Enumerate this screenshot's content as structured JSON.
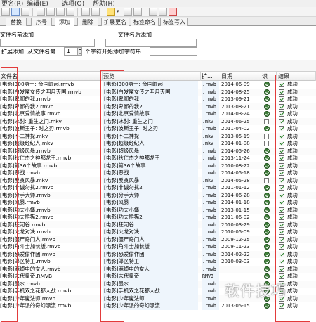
{
  "menubar": {
    "items": [
      "更名(R)",
      "编辑(E)",
      "选项(O)",
      "帮助(H)"
    ]
  },
  "tabs": [
    {
      "label": "替换",
      "active": false
    },
    {
      "label": "序号",
      "active": false
    },
    {
      "label": "添加",
      "active": true
    },
    {
      "label": "删除",
      "active": false
    },
    {
      "label": "扩展更名",
      "active": false
    },
    {
      "label": "标签命名",
      "active": false
    },
    {
      "label": "标签写入",
      "active": false
    }
  ],
  "options": {
    "prefix_label": "文件名前添加",
    "suffix_label": "文件名后添加",
    "ext_add_label": "扩展添加: 从文件名第",
    "ext_add_value": "1",
    "ext_add_suffix": "个字符开始添加字符串"
  },
  "table": {
    "headers": {
      "name": "文件名",
      "preview": "预览",
      "ext": "扩...",
      "date": "日期",
      "icon": "识",
      "result": "结果"
    },
    "rows": [
      {
        "name": "[电影]300勇士: 帝国崛起.rmvb",
        "preview": "[电影]300勇士: 帝国崛起",
        "ext": ".rmvb",
        "date": "2014-06-09",
        "icon": "ok",
        "result": "成功"
      },
      {
        "name": "[电影]白发魔女传之明月天国.rmvb",
        "preview": "[电影]白发魔女传之明月天国",
        "ext": ".rmvb",
        "date": "2014-08-25",
        "icon": "ok",
        "result": "成功"
      },
      {
        "name": "[电影]卑鄙的我.rmvb",
        "preview": "[电影]卑鄙的我",
        "ext": ".rmvb",
        "date": "2013-09-21",
        "icon": "ok",
        "result": "成功"
      },
      {
        "name": "[电影]卑鄙的我2.rmvb",
        "preview": "[电影]卑鄙的我2",
        "ext": ".rmvb",
        "date": "2013-08-21",
        "icon": "ok",
        "result": "成功"
      },
      {
        "name": "[电影]北京爱情故事.rmvb",
        "preview": "[电影]北京爱情故事",
        "ext": ".rmvb",
        "date": "2014-03-24",
        "icon": "ok",
        "result": "成功"
      },
      {
        "name": "[电影]冰封: 重生之门.mkv",
        "preview": "[电影]冰封: 重生之门",
        "ext": ".mkv",
        "date": "2014-06-25",
        "icon": "doc",
        "result": "成功"
      },
      {
        "name": "[电影]波斯王子: 时之刃.rmvb",
        "preview": "[电影]波斯王子: 时之刃",
        "ext": ".rmvb",
        "date": "2011-04-02",
        "icon": "ok",
        "result": "成功"
      },
      {
        "name": "[电影]不二神探.mkv",
        "preview": "[电影]不二神探",
        "ext": ".mkv",
        "date": "2013-05-19",
        "icon": "doc",
        "result": "成功"
      },
      {
        "name": "[电影]超级经纪人.mkv",
        "preview": "[电影]超级经纪人",
        "ext": ".mkv",
        "date": "2014-01-08",
        "icon": "doc",
        "result": "成功"
      },
      {
        "name": "[电影]超级风暴.rmvb",
        "preview": "[电影]超级风暴",
        "ext": ".rmvb",
        "date": "2014-05-26",
        "icon": "ok",
        "result": "成功"
      },
      {
        "name": "[电影]狄仁杰之神都龙王.rmvb",
        "preview": "[电影]狄仁杰之神都龙王",
        "ext": ".rmvb",
        "date": "2013-11-24",
        "icon": "ok",
        "result": "成功"
      },
      {
        "name": "[电影]第36个故事.rmvb",
        "preview": "[电影]第36个故事",
        "ext": ".rmvb",
        "date": "2010-08-22",
        "icon": "ok",
        "result": "成功"
      },
      {
        "name": "[电影]恶战.rmvb",
        "preview": "[电影]恶战",
        "ext": ".rmvb",
        "date": "2014-05-18",
        "icon": "ok",
        "result": "成功"
      },
      {
        "name": "[电影]反贪风暴.mkv",
        "preview": "[电影]反贪风暴",
        "ext": ".mkv",
        "date": "2014-05-28",
        "icon": "doc",
        "result": "成功"
      },
      {
        "name": "[电影]非诚勿扰2.rmvb",
        "preview": "[电影]非诚勿扰2",
        "ext": ".rmvb",
        "date": "2011-01-12",
        "icon": "ok",
        "result": "成功"
      },
      {
        "name": "[电影]分手大师.rmvb",
        "preview": "[电影]分手大师",
        "ext": ".rmvb",
        "date": "2014-06-28",
        "icon": "ok",
        "result": "成功"
      },
      {
        "name": "[电影]风暴.rmvb",
        "preview": "[电影]风暴",
        "ext": ".rmvb",
        "date": "2014-01-18",
        "icon": "ok",
        "result": "成功"
      },
      {
        "name": "[电影]功夫小蝇.rmvb",
        "preview": "[电影]功夫小蝇",
        "ext": ".rmvb",
        "date": "2013-01-15",
        "icon": "ok",
        "result": "成功"
      },
      {
        "name": "[电影]功夫熊猫2.rmvb",
        "preview": "[电影]功夫熊猫2",
        "ext": ".rmvb",
        "date": "2011-06-02",
        "icon": "ok",
        "result": "成功"
      },
      {
        "name": "[电影]狂河谷.rmvb",
        "preview": "[电影]狂河谷",
        "ext": ".rmvb",
        "date": "2010-03-29",
        "icon": "ok",
        "result": "成功"
      },
      {
        "name": "[电影]火龙对决.rmvb",
        "preview": "[电影]火龙对决",
        "ext": ".rmvb",
        "date": "2010-05-09",
        "icon": "ok",
        "result": "成功"
      },
      {
        "name": "[电影]僵尸奇门人.rmvb",
        "preview": "[电影]僵尸奇门人",
        "ext": ".rmvb",
        "date": "2009-12-25",
        "icon": "ok",
        "result": "成功"
      },
      {
        "name": "[电影]角斗士加长版.rmvb",
        "preview": "[电影]角斗士加长版",
        "ext": ".rmvb",
        "date": "2009-11-23",
        "icon": "ok",
        "result": "成功"
      },
      {
        "name": "[电影]恐爱偷作团.rmvb",
        "preview": "[电影]恐爱偷作团",
        "ext": ".rmvb",
        "date": "2014-02-22",
        "icon": "ok",
        "result": "成功"
      },
      {
        "name": "[电影]郊区特工.rmvb",
        "preview": "[电影]郊区特工",
        "ext": ".rmvb",
        "date": "2010-03-03",
        "icon": "ok",
        "result": "成功"
      },
      {
        "name": "[电影]麻烦中的女人.rmvb",
        "preview": "[电影]麻烦中的女人",
        "ext": ".rmvb",
        "date": "",
        "icon": "ok",
        "result": "成功"
      },
      {
        "name": "[电影]末代皇帝.RMVB",
        "preview": "[电影]末代皇帝",
        "ext": "RMVB",
        "date": "",
        "icon": "ok",
        "result": "成功"
      },
      {
        "name": "[电影]墨水.rmvb",
        "preview": "[电影]墨水",
        "ext": ".rmvb",
        "date": "",
        "icon": "ok",
        "result": "成功"
      },
      {
        "name": "[电影]手机双之花都大战.rmvb",
        "preview": "[电影]手机双之花都大战",
        "ext": ".rmvb",
        "date": "",
        "icon": "ok",
        "result": "成功"
      },
      {
        "name": "[电影]少年魔法师.rmvb",
        "preview": "[电影]少年魔法师",
        "ext": ".rmvb",
        "date": "",
        "icon": "ok",
        "result": "成功"
      },
      {
        "name": "[电影]少年派的奇幻漂流.rmvb",
        "preview": "[电影]少年派的奇幻漂流",
        "ext": ".rmvb",
        "date": "2013-05-15",
        "icon": "ok",
        "result": "成功"
      }
    ]
  },
  "watermark": "软件技巧",
  "colors": {
    "highlight": "#e23b3b",
    "preview_bg": "#eef5fc",
    "ok_icon": "#3f7f3a"
  }
}
